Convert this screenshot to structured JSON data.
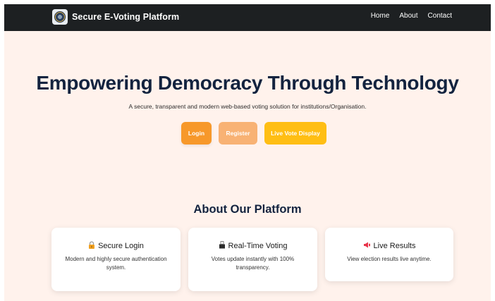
{
  "navbar": {
    "brand": "Secure E-Voting Platform",
    "links": [
      "Home",
      "About",
      "Contact"
    ]
  },
  "hero": {
    "title": "Empowering Democracy Through Technology",
    "subtitle": "A secure, transparent and modern web-based voting solution for institutions/Organisation.",
    "buttons": {
      "login": "Login",
      "register": "Register",
      "live": "Live Vote Display"
    }
  },
  "about": {
    "title": "About Our Platform",
    "cards": [
      {
        "icon": "lock-icon",
        "title": "Secure Login",
        "desc": "Modern and highly secure authentication system."
      },
      {
        "icon": "ballot-box-icon",
        "title": "Real-Time Voting",
        "desc": "Votes update instantly with 100% transparency."
      },
      {
        "icon": "megaphone-icon",
        "title": "Live Results",
        "desc": "View election results live anytime."
      }
    ]
  },
  "colors": {
    "navbar": "#1d2022",
    "page_background": "#fff2ec",
    "heading": "#13233f",
    "login_button": "#f7982a",
    "register_button": "#f8b274",
    "live_button": "#ffbe14"
  }
}
